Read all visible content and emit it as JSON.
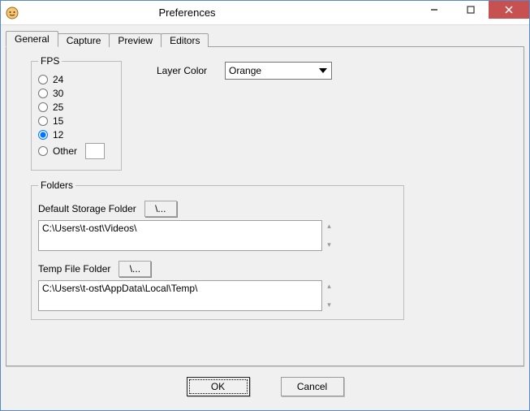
{
  "window": {
    "title": "Preferences"
  },
  "tabs": {
    "general": "General",
    "capture": "Capture",
    "preview": "Preview",
    "editors": "Editors"
  },
  "fps": {
    "legend": "FPS",
    "options": {
      "v24": "24",
      "v30": "30",
      "v25": "25",
      "v15": "15",
      "v12": "12",
      "other": "Other"
    },
    "selected": "12",
    "other_value": ""
  },
  "layer_color": {
    "label": "Layer Color",
    "value": "Orange"
  },
  "folders": {
    "legend": "Folders",
    "default_label": "Default Storage Folder",
    "default_path": "C:\\Users\\t-ost\\Videos\\",
    "temp_label": "Temp File Folder",
    "temp_path": "C:\\Users\\t-ost\\AppData\\Local\\Temp\\",
    "browse_label": "\\..."
  },
  "buttons": {
    "ok": "OK",
    "cancel": "Cancel"
  }
}
